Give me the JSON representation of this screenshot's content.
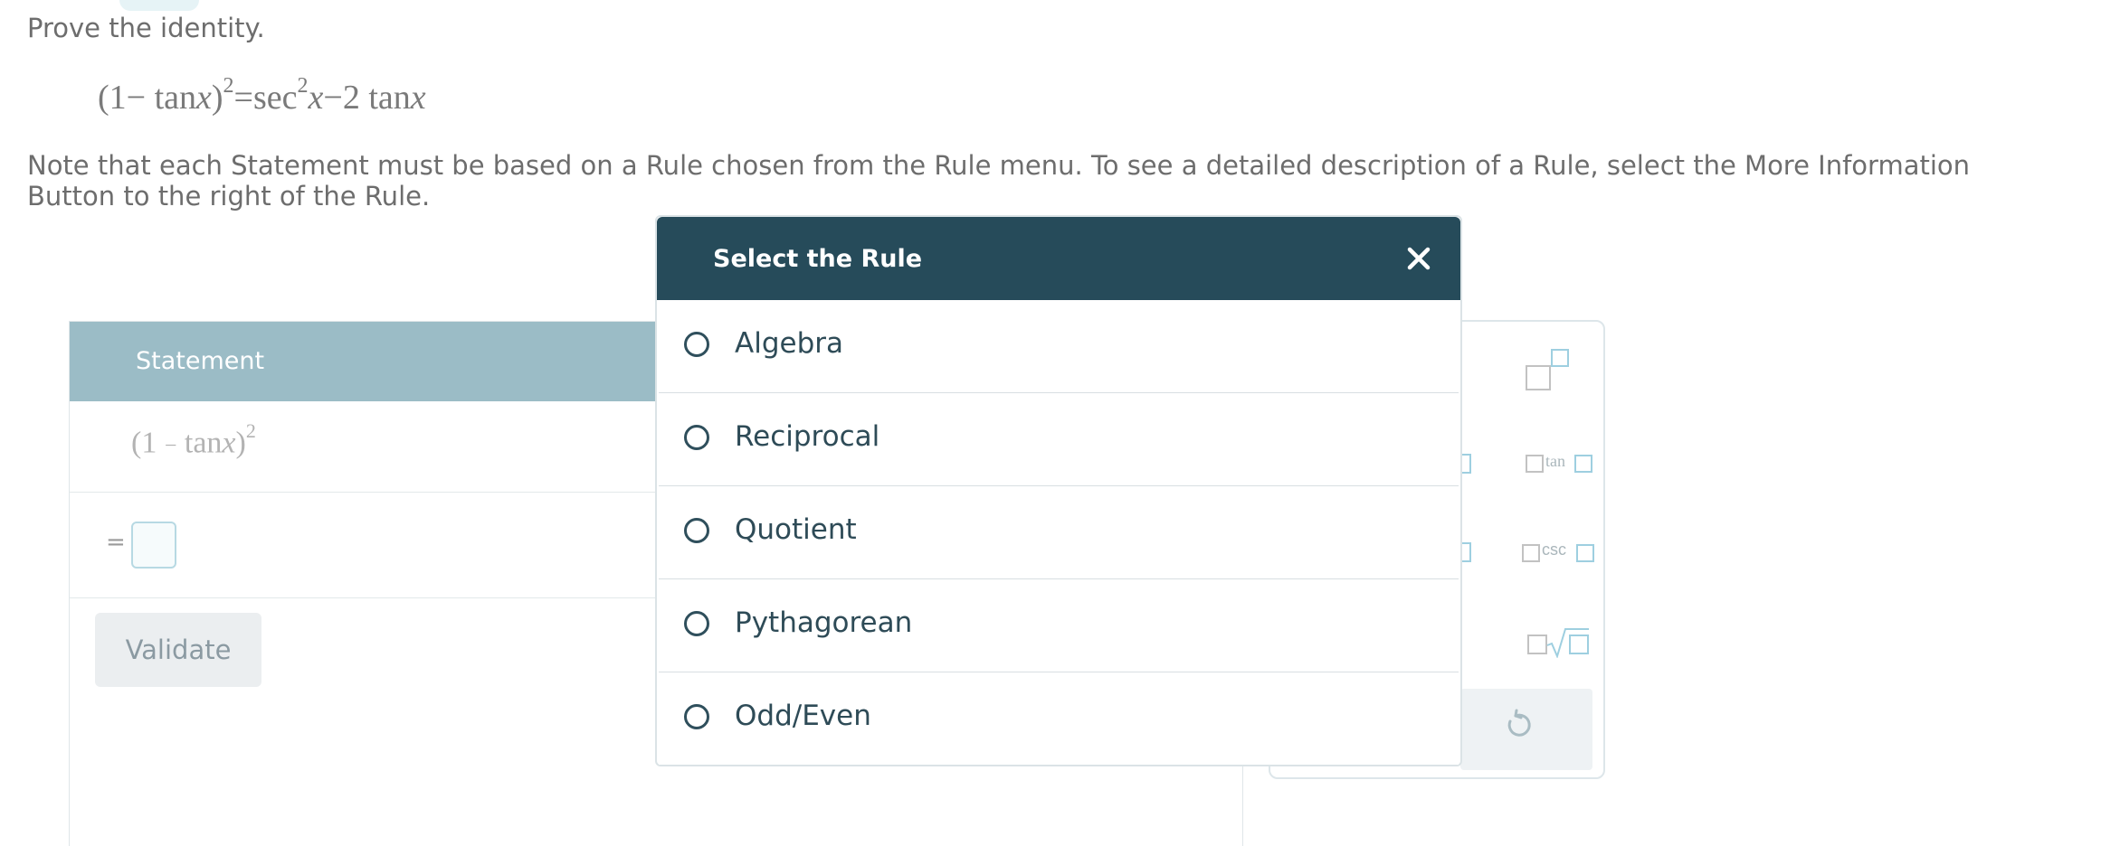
{
  "prompt": "Prove the identity.",
  "identity": {
    "lhs_open": "(1− tan",
    "lhs_var": "x",
    "lhs_close": ")",
    "lhs_exp": "2",
    "equals": "=",
    "rhs_sec": "sec",
    "rhs_sec_exp": "2",
    "rhs_var": "x",
    "rhs_minus": "−2 tan",
    "rhs_var2": "x"
  },
  "note": "Note that each Statement must be based on a Rule chosen from the Rule menu. To see a detailed description of a Rule, select the More Information Button to the right of the Rule.",
  "proof": {
    "header_statement": "Statement",
    "row1_open": "(1",
    "row1_minus": "−",
    "row1_tan": "tan",
    "row1_var": "x",
    "row1_close": ")",
    "row1_exp": "2",
    "row2_equals": "=",
    "validate_label": "Validate"
  },
  "palette": {
    "tan_label": "tan",
    "csc_label": "csc",
    "icons": [
      "superscript-template-icon",
      "tan-template-icon",
      "csc-template-icon",
      "nth-root-template-icon",
      "undo-icon"
    ]
  },
  "modal": {
    "title": "Select the Rule",
    "close_icon": "close-icon",
    "options": [
      "Algebra",
      "Reciprocal",
      "Quotient",
      "Pythagorean",
      "Odd/Even"
    ]
  },
  "colors": {
    "modal_header": "#264b5a",
    "table_header": "#9bbcc6",
    "palette_accent": "#9ecfe0"
  }
}
